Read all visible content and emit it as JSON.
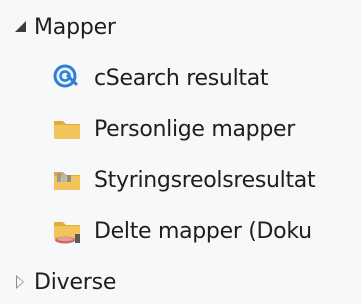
{
  "tree": {
    "groups": [
      {
        "label": "Mapper",
        "state": "expanded",
        "items": [
          {
            "label": "cSearch resultat",
            "icon": "search-results-icon"
          },
          {
            "label": "Personlige mapper",
            "icon": "folder-icon"
          },
          {
            "label": "Styringsreolsresultat",
            "icon": "archive-folder-icon"
          },
          {
            "label": "Delte mapper (Doku",
            "icon": "shared-folder-icon"
          }
        ]
      },
      {
        "label": "Diverse",
        "state": "collapsed",
        "items": []
      }
    ]
  },
  "colors": {
    "background": "#f7f8f9",
    "text": "#1e1e1e",
    "folder": "#f2c55c",
    "search_icon": "#2f7fd6"
  }
}
